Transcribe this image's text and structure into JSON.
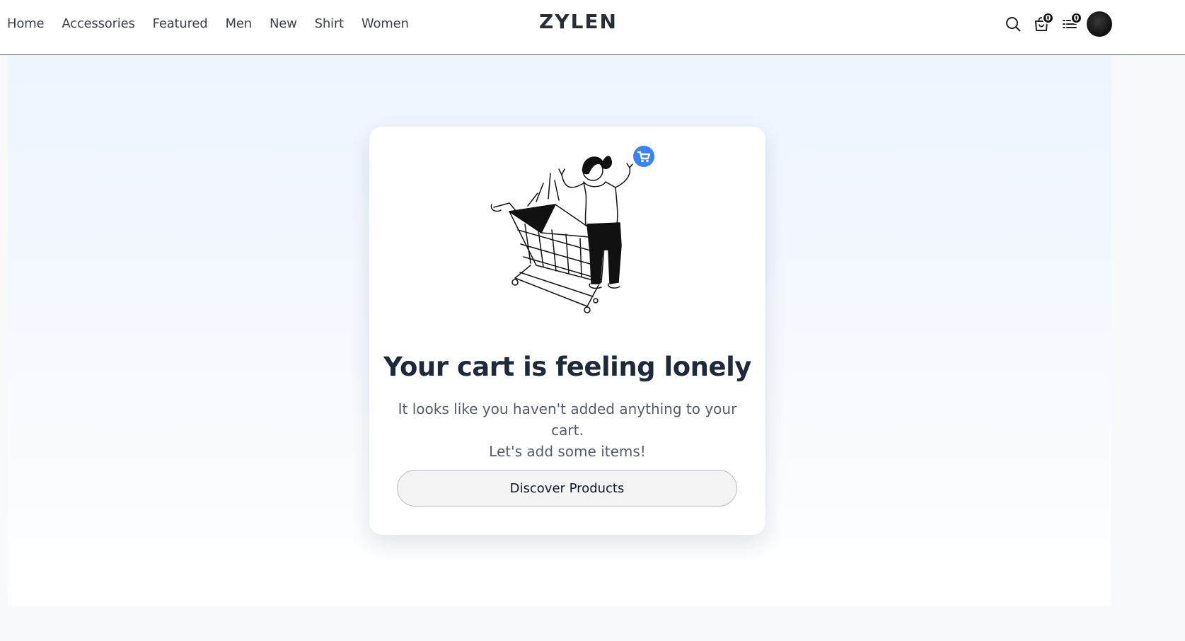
{
  "nav": {
    "items": [
      {
        "label": "Home"
      },
      {
        "label": "Accessories"
      },
      {
        "label": "Featured"
      },
      {
        "label": "Men"
      },
      {
        "label": "New"
      },
      {
        "label": "Shirt"
      },
      {
        "label": "Women"
      }
    ]
  },
  "brand": {
    "logo_text": "ZYLEN"
  },
  "header_icons": {
    "search": {
      "icon": "search-icon"
    },
    "cart": {
      "icon": "shopping-bag-icon",
      "count": "0"
    },
    "list": {
      "icon": "list-icon",
      "count": "0"
    },
    "avatar": {
      "icon": "avatar"
    }
  },
  "empty_cart": {
    "title": "Your cart is feeling lonely",
    "message_line1": "It looks like you haven't added anything to your cart.",
    "message_line2": "Let's add some items!",
    "cta_label": "Discover Products",
    "illustration": "empty-cart-illustration",
    "accent_color": "#3b82f6"
  }
}
